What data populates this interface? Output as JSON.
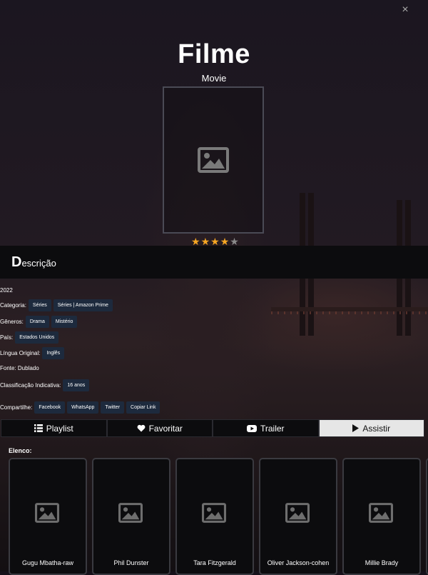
{
  "header": {
    "title": "Filme",
    "subtitle": "Movie",
    "close_label": "×"
  },
  "rating": {
    "value": 4,
    "max": 5,
    "filled_color": "#f5a623",
    "empty_color": "#8a8a8a"
  },
  "description": {
    "heading_first": "D",
    "heading_rest": "escrição"
  },
  "info": {
    "year": "2022",
    "categoria_label": "Categoria:",
    "categorias": [
      "Séries",
      "Séries | Amazon Prime"
    ],
    "generos_label": "Gêneros:",
    "generos": [
      "Drama",
      "Mistério"
    ],
    "pais_label": "País:",
    "pais": [
      "Estados Unidos"
    ],
    "lingua_label": "Língua Original:",
    "lingua": [
      "Inglês"
    ],
    "fonte": "Fonte: Dublado",
    "classificacao_label": "Classificação Indicativa:",
    "classificacao": [
      "16 anos"
    ],
    "compartilhe_label": "Compartilhe:",
    "compartilhe": [
      "Facebook",
      "WhatsApp",
      "Twitter",
      "Copiar Link"
    ]
  },
  "actions": {
    "playlist": "Playlist",
    "favoritar": "Favoritar",
    "trailer": "Trailer",
    "assistir": "Assistir"
  },
  "cast": {
    "label": "Elenco:",
    "members": [
      "Gugu Mbatha-raw",
      "Phil Dunster",
      "Tara Fitzgerald",
      "Oliver Jackson-cohen",
      "Millie Brady"
    ]
  },
  "icons": {
    "close": "close-icon",
    "placeholder": "image-placeholder-icon",
    "list": "list-icon",
    "heart": "heart-icon",
    "youtube": "youtube-icon",
    "play": "play-icon"
  },
  "colors": {
    "tag_bg": "#1d2a3d",
    "active_button_bg": "#e6e6e6",
    "star": "#f5a623"
  }
}
